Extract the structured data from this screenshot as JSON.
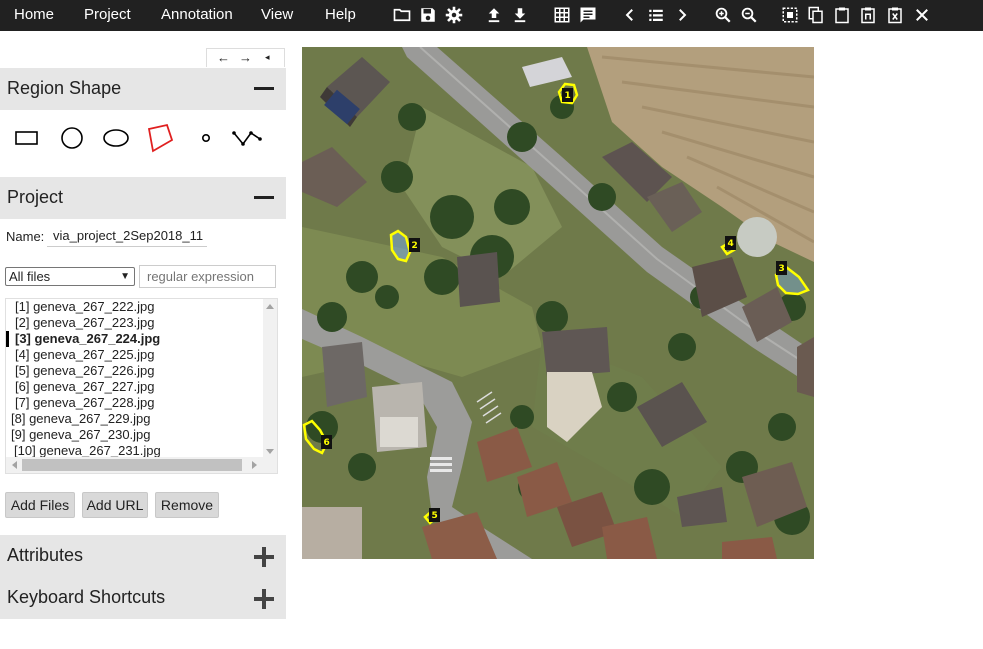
{
  "menu": {
    "items": [
      "Home",
      "Project",
      "Annotation",
      "View",
      "Help"
    ]
  },
  "toolbar": {
    "icons": [
      "folder-open-icon",
      "save-icon",
      "settings-icon",
      "upload-icon",
      "download-icon",
      "grid-view-icon",
      "comment-icon",
      "prev-image-icon",
      "list-icon",
      "next-image-icon",
      "zoom-in-icon",
      "zoom-out-icon",
      "select-all-icon",
      "copy-icon",
      "paste-icon",
      "paste-nth-icon",
      "delete-region-icon",
      "close-icon"
    ]
  },
  "panel_nav": {
    "left": "←",
    "right": "→",
    "collapse": "◂"
  },
  "region_shape": {
    "title": "Region Shape",
    "shapes": [
      "rectangle",
      "circle",
      "ellipse",
      "polygon",
      "point",
      "polyline"
    ],
    "selected": "polygon",
    "selected_color": "#e02020"
  },
  "project": {
    "title": "Project",
    "name_label": "Name:",
    "name_value": "via_project_2Sep2018_11",
    "filter_selected": "All files",
    "regex_placeholder": "regular expression",
    "files": [
      {
        "label": "[1] geneva_267_222.jpg",
        "active": false
      },
      {
        "label": "[2] geneva_267_223.jpg",
        "active": false
      },
      {
        "label": "[3] geneva_267_224.jpg",
        "active": true
      },
      {
        "label": "[4] geneva_267_225.jpg",
        "active": false
      },
      {
        "label": "[5] geneva_267_226.jpg",
        "active": false
      },
      {
        "label": "[6] geneva_267_227.jpg",
        "active": false
      },
      {
        "label": "[7] geneva_267_228.jpg",
        "active": false
      },
      {
        "label": "[8] geneva_267_229.jpg",
        "active": false
      },
      {
        "label": "[9] geneva_267_230.jpg",
        "active": false
      },
      {
        "label": "[10] geneva_267_231.jpg",
        "active": false
      }
    ],
    "buttons": {
      "add_files": "Add Files",
      "add_url": "Add URL",
      "remove": "Remove"
    }
  },
  "attributes": {
    "title": "Attributes"
  },
  "keyboard_shortcuts": {
    "title": "Keyboard Shortcuts"
  },
  "regions": [
    {
      "id": "1"
    },
    {
      "id": "2"
    },
    {
      "id": "3"
    },
    {
      "id": "4"
    },
    {
      "id": "5"
    },
    {
      "id": "6"
    }
  ],
  "colors": {
    "topbar": "#212121",
    "section_header": "#e6e6e6",
    "region_stroke": "#ffff00",
    "region_label_bg": "#111111",
    "region_label_text": "#ffff00"
  }
}
